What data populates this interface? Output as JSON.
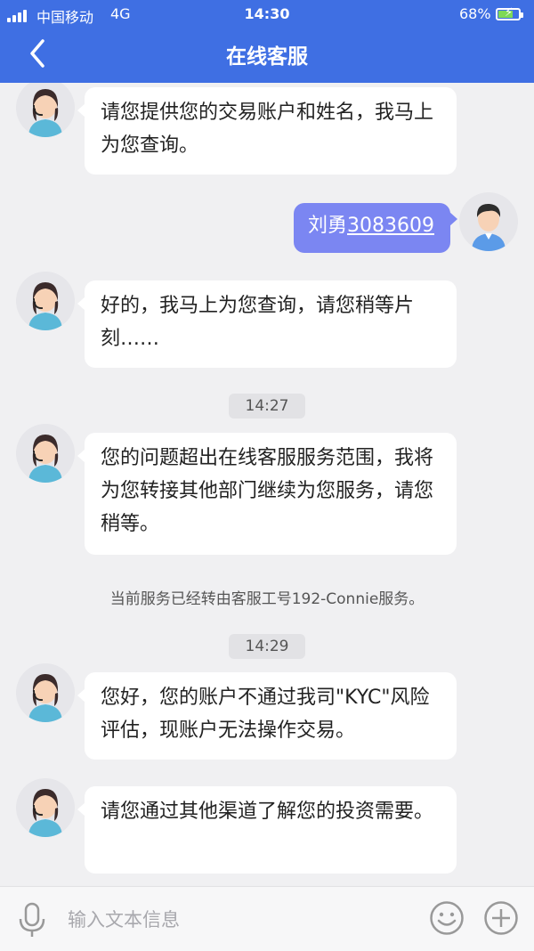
{
  "status_bar": {
    "carrier": "中国移动",
    "network": "4G",
    "time": "14:30",
    "battery": "68%"
  },
  "header": {
    "title": "在线客服"
  },
  "messages": [
    {
      "text": "请您提供您的交易账户和姓名，我马上为您查询。"
    },
    {
      "name": "刘勇",
      "account": "3083609"
    },
    {
      "text": "好的，我马上为您查询，请您稍等片刻……"
    },
    {
      "time": "14:27"
    },
    {
      "text": "您的问题超出在线客服服务范围，我将为您转接其他部门继续为您服务，请您稍等。"
    },
    {
      "note": "当前服务已经转由客服工号192-Connie服务。"
    },
    {
      "time": "14:29"
    },
    {
      "text": "您好，您的账户不通过我司\"KYC\"风险评估，现账户无法操作交易。"
    },
    {
      "text": "请您通过其他渠道了解您的投资需要。"
    }
  ],
  "input_bar": {
    "placeholder": "输入文本信息"
  },
  "colors": {
    "header": "#3f6fe3",
    "user_bubble": "#7b86f2",
    "agent_bubble": "#ffffff",
    "background": "#f0f0f2"
  },
  "icons": [
    "back-arrow-icon",
    "microphone-icon",
    "emoji-icon",
    "plus-icon",
    "agent-avatar",
    "user-avatar"
  ]
}
